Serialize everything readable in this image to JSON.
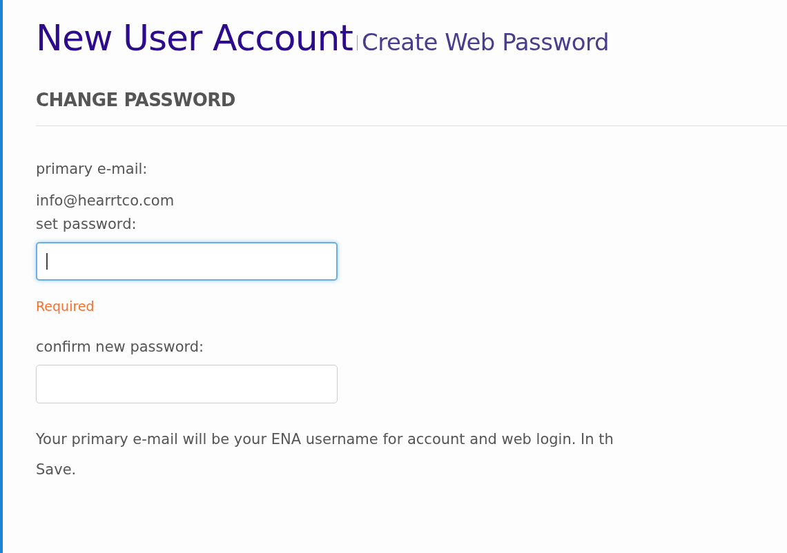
{
  "header": {
    "title": "New User Account",
    "subtitle": "Create Web Password"
  },
  "section": {
    "heading": "CHANGE PASSWORD"
  },
  "form": {
    "email_label": "primary e-mail:",
    "email_value": "info@hearrtco.com",
    "fields": [
      {
        "label": "set password:",
        "focused": true,
        "error": "Required"
      },
      {
        "label": "confirm new password:",
        "focused": false
      }
    ]
  },
  "note_lines": [
    "Your primary e-mail will be your ENA username for account and web login. In th",
    "Save."
  ]
}
